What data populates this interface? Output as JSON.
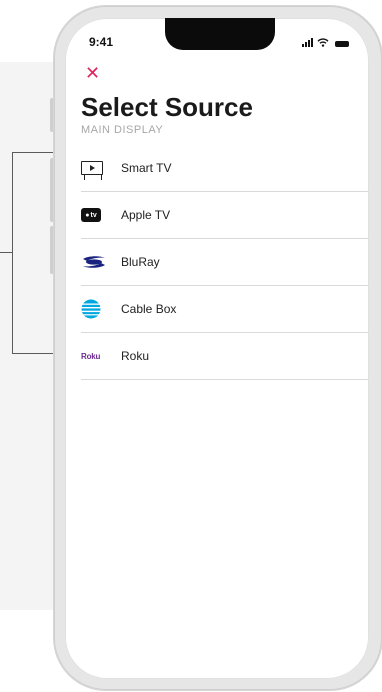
{
  "status": {
    "time": "9:41"
  },
  "header": {
    "close_glyph": "✕",
    "title": "Select Source",
    "subtitle": "MAIN DISPLAY"
  },
  "annotation": {
    "dots": "..."
  },
  "sources": [
    {
      "label": "Smart TV",
      "icon": "smart-tv-icon"
    },
    {
      "label": "Apple TV",
      "icon": "apple-tv-icon",
      "icon_text": "tv"
    },
    {
      "label": "BluRay",
      "icon": "bluray-icon"
    },
    {
      "label": "Cable Box",
      "icon": "att-globe-icon"
    },
    {
      "label": "Roku",
      "icon": "roku-icon",
      "icon_text": "Roku"
    }
  ],
  "colors": {
    "accent_close": "#e0245e",
    "roku_purple": "#6a2c91",
    "att_blue": "#00a8e0"
  }
}
